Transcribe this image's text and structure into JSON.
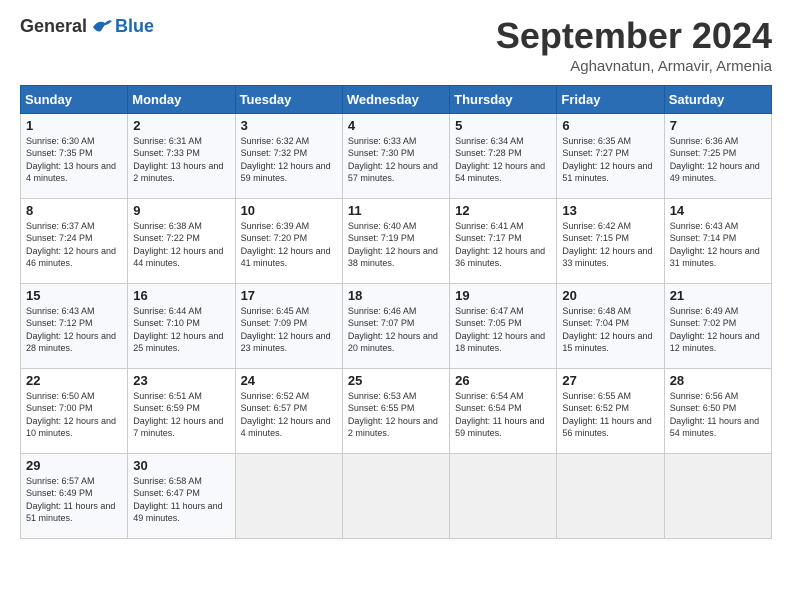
{
  "header": {
    "logo_general": "General",
    "logo_blue": "Blue",
    "month_title": "September 2024",
    "subtitle": "Aghavnatun, Armavir, Armenia"
  },
  "days_of_week": [
    "Sunday",
    "Monday",
    "Tuesday",
    "Wednesday",
    "Thursday",
    "Friday",
    "Saturday"
  ],
  "weeks": [
    [
      {
        "day": 1,
        "sunrise": "6:30 AM",
        "sunset": "7:35 PM",
        "daylight": "13 hours and 4 minutes."
      },
      {
        "day": 2,
        "sunrise": "6:31 AM",
        "sunset": "7:33 PM",
        "daylight": "13 hours and 2 minutes."
      },
      {
        "day": 3,
        "sunrise": "6:32 AM",
        "sunset": "7:32 PM",
        "daylight": "12 hours and 59 minutes."
      },
      {
        "day": 4,
        "sunrise": "6:33 AM",
        "sunset": "7:30 PM",
        "daylight": "12 hours and 57 minutes."
      },
      {
        "day": 5,
        "sunrise": "6:34 AM",
        "sunset": "7:28 PM",
        "daylight": "12 hours and 54 minutes."
      },
      {
        "day": 6,
        "sunrise": "6:35 AM",
        "sunset": "7:27 PM",
        "daylight": "12 hours and 51 minutes."
      },
      {
        "day": 7,
        "sunrise": "6:36 AM",
        "sunset": "7:25 PM",
        "daylight": "12 hours and 49 minutes."
      }
    ],
    [
      {
        "day": 8,
        "sunrise": "6:37 AM",
        "sunset": "7:24 PM",
        "daylight": "12 hours and 46 minutes."
      },
      {
        "day": 9,
        "sunrise": "6:38 AM",
        "sunset": "7:22 PM",
        "daylight": "12 hours and 44 minutes."
      },
      {
        "day": 10,
        "sunrise": "6:39 AM",
        "sunset": "7:20 PM",
        "daylight": "12 hours and 41 minutes."
      },
      {
        "day": 11,
        "sunrise": "6:40 AM",
        "sunset": "7:19 PM",
        "daylight": "12 hours and 38 minutes."
      },
      {
        "day": 12,
        "sunrise": "6:41 AM",
        "sunset": "7:17 PM",
        "daylight": "12 hours and 36 minutes."
      },
      {
        "day": 13,
        "sunrise": "6:42 AM",
        "sunset": "7:15 PM",
        "daylight": "12 hours and 33 minutes."
      },
      {
        "day": 14,
        "sunrise": "6:43 AM",
        "sunset": "7:14 PM",
        "daylight": "12 hours and 31 minutes."
      }
    ],
    [
      {
        "day": 15,
        "sunrise": "6:43 AM",
        "sunset": "7:12 PM",
        "daylight": "12 hours and 28 minutes."
      },
      {
        "day": 16,
        "sunrise": "6:44 AM",
        "sunset": "7:10 PM",
        "daylight": "12 hours and 25 minutes."
      },
      {
        "day": 17,
        "sunrise": "6:45 AM",
        "sunset": "7:09 PM",
        "daylight": "12 hours and 23 minutes."
      },
      {
        "day": 18,
        "sunrise": "6:46 AM",
        "sunset": "7:07 PM",
        "daylight": "12 hours and 20 minutes."
      },
      {
        "day": 19,
        "sunrise": "6:47 AM",
        "sunset": "7:05 PM",
        "daylight": "12 hours and 18 minutes."
      },
      {
        "day": 20,
        "sunrise": "6:48 AM",
        "sunset": "7:04 PM",
        "daylight": "12 hours and 15 minutes."
      },
      {
        "day": 21,
        "sunrise": "6:49 AM",
        "sunset": "7:02 PM",
        "daylight": "12 hours and 12 minutes."
      }
    ],
    [
      {
        "day": 22,
        "sunrise": "6:50 AM",
        "sunset": "7:00 PM",
        "daylight": "12 hours and 10 minutes."
      },
      {
        "day": 23,
        "sunrise": "6:51 AM",
        "sunset": "6:59 PM",
        "daylight": "12 hours and 7 minutes."
      },
      {
        "day": 24,
        "sunrise": "6:52 AM",
        "sunset": "6:57 PM",
        "daylight": "12 hours and 4 minutes."
      },
      {
        "day": 25,
        "sunrise": "6:53 AM",
        "sunset": "6:55 PM",
        "daylight": "12 hours and 2 minutes."
      },
      {
        "day": 26,
        "sunrise": "6:54 AM",
        "sunset": "6:54 PM",
        "daylight": "11 hours and 59 minutes."
      },
      {
        "day": 27,
        "sunrise": "6:55 AM",
        "sunset": "6:52 PM",
        "daylight": "11 hours and 56 minutes."
      },
      {
        "day": 28,
        "sunrise": "6:56 AM",
        "sunset": "6:50 PM",
        "daylight": "11 hours and 54 minutes."
      }
    ],
    [
      {
        "day": 29,
        "sunrise": "6:57 AM",
        "sunset": "6:49 PM",
        "daylight": "11 hours and 51 minutes."
      },
      {
        "day": 30,
        "sunrise": "6:58 AM",
        "sunset": "6:47 PM",
        "daylight": "11 hours and 49 minutes."
      },
      null,
      null,
      null,
      null,
      null
    ]
  ]
}
